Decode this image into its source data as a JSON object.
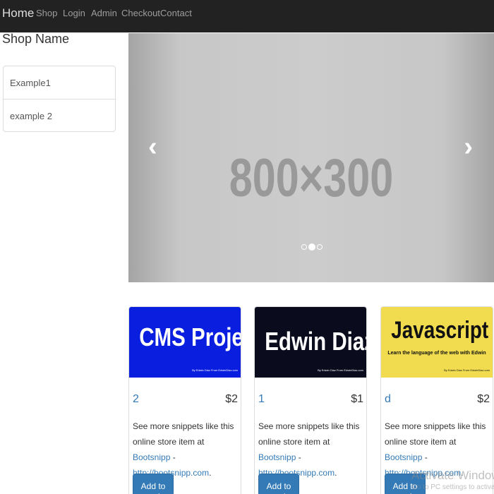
{
  "navbar": {
    "brand": "Home",
    "links": [
      "Shop",
      "Login",
      "Admin",
      "Checkout",
      "Contact"
    ]
  },
  "sidebar": {
    "shop_name": "Shop Name",
    "items": [
      "Example1",
      "example 2"
    ]
  },
  "carousel": {
    "placeholder_text": "800×300",
    "prev_icon": "‹",
    "next_icon": "›",
    "slide_count": 3,
    "active_slide": 2
  },
  "products": [
    {
      "banner_title": "CMS Project",
      "banner_subtitle": "",
      "banner_credit": "By Edwin Diaz From EdwinDiaz.com",
      "banner_bg": "#0a1ee0",
      "banner_fg": "#ffffff",
      "name": "2",
      "price": "$2",
      "desc_prefix": "See more snippets like this online store item at ",
      "desc_link1": "Bootsnipp",
      "desc_sep": " - ",
      "desc_link2": "http://bootsnipp.com",
      "desc_suffix": ".",
      "button": "Add to cart"
    },
    {
      "banner_title": "Edwin Diaz",
      "banner_subtitle": "",
      "banner_credit": "By Edwin Diaz From EdwinDiaz.com",
      "banner_bg": "#0b0b1e",
      "banner_fg": "#ffffff",
      "name": "1",
      "price": "$1",
      "desc_prefix": "See more snippets like this online store item at ",
      "desc_link1": "Bootsnipp",
      "desc_sep": " - ",
      "desc_link2": "http://bootsnipp.com",
      "desc_suffix": ".",
      "button": "Add to cart"
    },
    {
      "banner_title": "Javascript",
      "banner_subtitle": "Learn the language of the web with Edwin",
      "banner_credit": "By Edwin Diaz From EdwinDiaz.com",
      "banner_bg": "#f0dc4e",
      "banner_fg": "#111111",
      "name": "d",
      "price": "$2",
      "desc_prefix": "See more snippets like this online store item at ",
      "desc_link1": "Bootsnipp",
      "desc_sep": " - ",
      "desc_link2": "http://bootsnipp.com",
      "desc_suffix": ".",
      "button": "Add to cart"
    }
  ],
  "watermark": {
    "title": "Activate Windows",
    "subtitle": "Go to PC settings to activate"
  }
}
